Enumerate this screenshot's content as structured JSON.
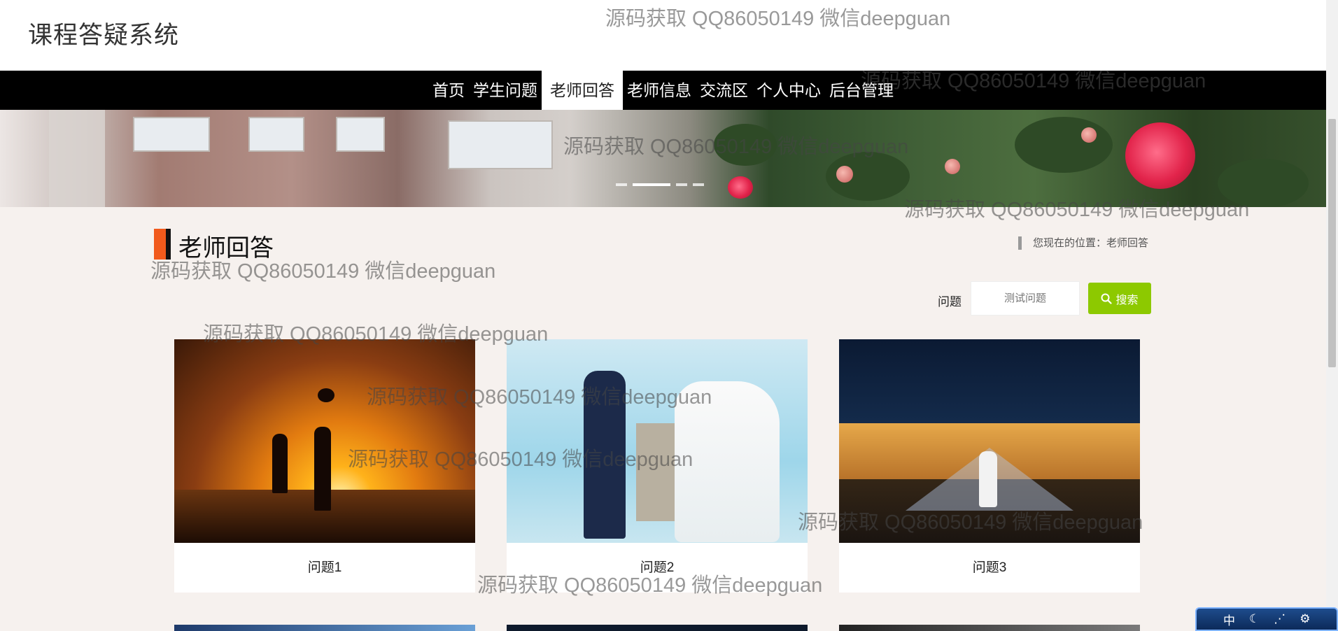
{
  "header": {
    "site_title": "课程答疑系统"
  },
  "nav": {
    "items": [
      {
        "label": "首页"
      },
      {
        "label": "学生问题"
      },
      {
        "label": "老师回答"
      },
      {
        "label": "老师信息"
      },
      {
        "label": "交流区"
      },
      {
        "label": "个人中心"
      },
      {
        "label": "后台管理"
      }
    ],
    "active": "老师回答"
  },
  "banner": {
    "slide_count": 4,
    "active_slide": 2
  },
  "page": {
    "title": "老师回答",
    "breadcrumb": "您现在的位置：老师回答"
  },
  "search": {
    "label": "问题",
    "placeholder": "测试问题",
    "button_label": "搜索"
  },
  "cards": [
    {
      "caption": "问题1"
    },
    {
      "caption": "问题2"
    },
    {
      "caption": "问题3"
    }
  ],
  "watermark": "源码获取 QQ86050149 微信deepguan",
  "ime": {
    "label": "中"
  },
  "colors": {
    "nav_bg": "#000000",
    "accent_orange": "#f15a1c",
    "search_button": "#8dc900",
    "page_bg": "#f6f1ee"
  }
}
